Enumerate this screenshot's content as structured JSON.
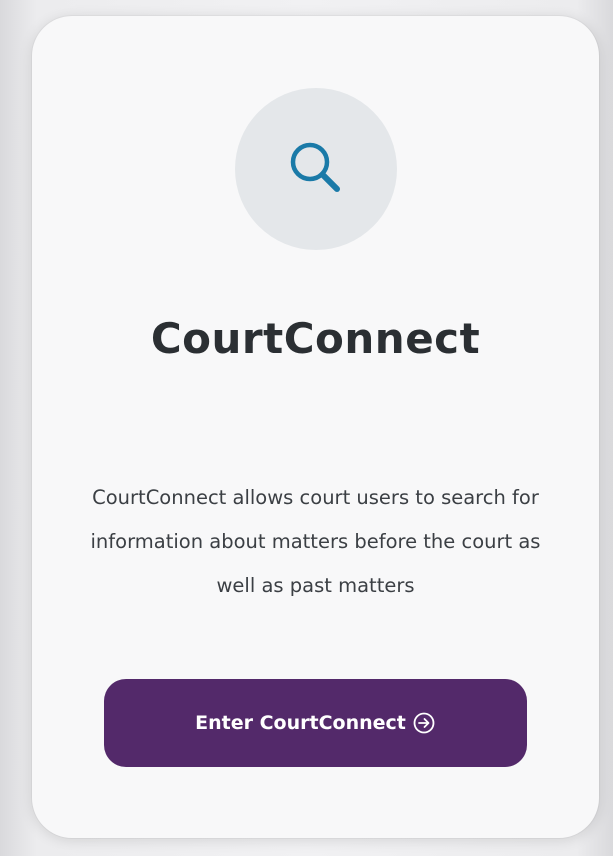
{
  "app": {
    "title": "CourtConnect",
    "description": "CourtConnect allows court users to search for information about matters before the court as well as past matters",
    "icon": "search-icon"
  },
  "actions": {
    "enter_label": "Enter CourtConnect",
    "enter_icon": "arrow-circle-right-icon"
  },
  "colors": {
    "accent": "#53296a",
    "icon_blue": "#1a7aa8",
    "title": "#2b2f33"
  }
}
